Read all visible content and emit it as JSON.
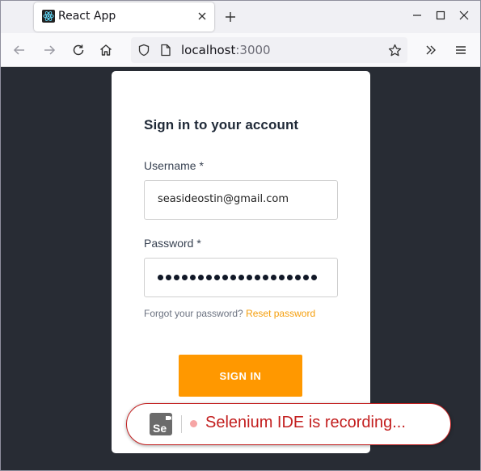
{
  "browser": {
    "tab": {
      "title": "React App",
      "favicon": "react-logo-icon"
    },
    "url": {
      "host": "localhost",
      "port": ":3000"
    },
    "icons": {
      "new_tab": "plus-icon",
      "minimize": "minimize-icon",
      "maximize": "maximize-icon",
      "close": "close-icon",
      "back": "back-arrow-icon",
      "forward": "forward-arrow-icon",
      "reload": "reload-icon",
      "home": "home-icon",
      "shield": "shield-icon",
      "page": "page-icon",
      "bookmark": "star-icon",
      "overflow": "chevrons-right-icon",
      "menu": "hamburger-menu-icon"
    }
  },
  "login": {
    "title": "Sign in to your account",
    "username_label": "Username *",
    "username_value": "seasideostin@gmail.com",
    "password_label": "Password *",
    "password_length": 20,
    "forgot_text": "Forgot your password?",
    "reset_link": "Reset password",
    "submit_label": "SIGN IN"
  },
  "recorder": {
    "text": "Selenium IDE is recording...",
    "logo_text": "Se"
  },
  "colors": {
    "page_background": "#282c34",
    "accent": "#ff9800",
    "link": "#f59e0b",
    "recording_red": "#c31f1f"
  }
}
